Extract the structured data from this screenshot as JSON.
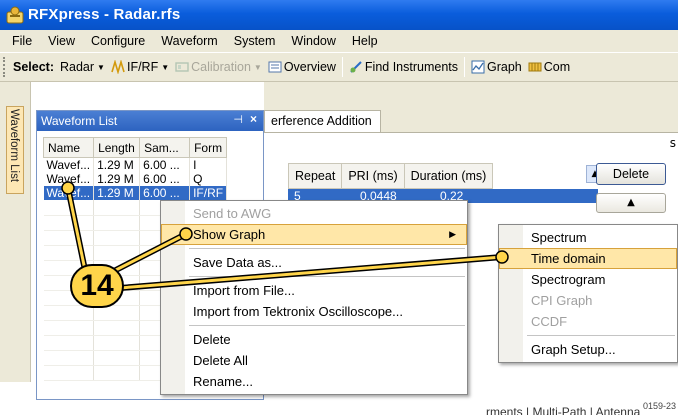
{
  "window": {
    "title": "RFXpress - Radar.rfs",
    "icon": "rfxpress-app-icon"
  },
  "menubar": {
    "items": [
      "File",
      "View",
      "Configure",
      "Waveform",
      "System",
      "Window",
      "Help"
    ]
  },
  "toolbar": {
    "select_label": "Select:",
    "radar": "Radar",
    "ifrf": "IF/RF",
    "calibration": "Calibration",
    "overview": "Overview",
    "find_instruments": "Find Instruments",
    "graph": "Graph",
    "com": "Com"
  },
  "side_tab": {
    "label": "Waveform List"
  },
  "waveform_list": {
    "title": "Waveform List",
    "columns": [
      "Name",
      "Length",
      "Sam...",
      "Form"
    ],
    "rows": [
      [
        "Wavef...",
        "1.29 M",
        "6.00 ...",
        "I"
      ],
      [
        "Wavef...",
        "1.29 M",
        "6.00 ...",
        "Q"
      ],
      [
        "Wavef...",
        "1.29 M",
        "6.00 ...",
        "IF/RF"
      ]
    ],
    "selected_row": 2
  },
  "document": {
    "tab_label": "erference Addition",
    "columns": [
      "Repeat",
      "PRI (ms)",
      "Duration (ms)"
    ],
    "row1": [
      "5",
      "0.0448",
      "0.22"
    ],
    "delete_label": "Delete",
    "s_label": "s",
    "bottom_tabs": "rments | Multi-Path | Antenna"
  },
  "context_menu": {
    "items": [
      {
        "label": "Send to AWG",
        "disabled": true
      },
      {
        "label": "Show Graph",
        "hover": true,
        "submenu": true
      },
      {
        "sep": true
      },
      {
        "label": "Save Data as..."
      },
      {
        "sep": true
      },
      {
        "label": "Import from File..."
      },
      {
        "label": "Import from Tektronix Oscilloscope..."
      },
      {
        "sep": true
      },
      {
        "label": "Delete"
      },
      {
        "label": "Delete All"
      },
      {
        "label": "Rename..."
      }
    ]
  },
  "submenu": {
    "items": [
      {
        "label": "Spectrum"
      },
      {
        "label": "Time domain",
        "hover": true
      },
      {
        "label": "Spectrogram"
      },
      {
        "label": "CPI Graph",
        "disabled": true
      },
      {
        "label": "CCDF",
        "disabled": true
      },
      {
        "sep": true
      },
      {
        "label": "Graph Setup..."
      }
    ]
  },
  "callout": {
    "number": "14",
    "fill": "#ffd54a"
  },
  "figure_id": "0159-23"
}
